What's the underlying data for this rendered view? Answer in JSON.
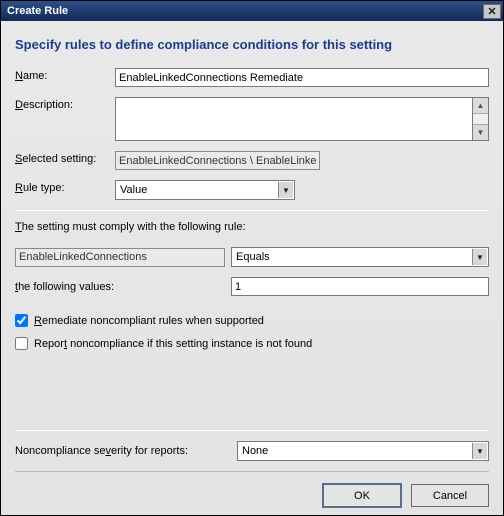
{
  "window": {
    "title": "Create Rule"
  },
  "header": {
    "heading": "Specify rules to define compliance conditions for this setting"
  },
  "labels": {
    "name": "Name:",
    "description": "Description:",
    "selected_setting": "Selected setting:",
    "rule_type": "Rule type:",
    "rule_sentence": "The setting must comply with the following rule:",
    "following_values": "the following values:",
    "remediate": "Remediate noncompliant rules when supported",
    "report_noncompliance": "Report noncompliance if this setting instance is not found",
    "severity": "Noncompliance severity for reports:"
  },
  "fields": {
    "name_value": "EnableLinkedConnections Remediate",
    "description_value": "",
    "selected_setting_value": "EnableLinkedConnections \\ EnableLinkedCon",
    "rule_type_value": "Value",
    "rule_setting_name": "EnableLinkedConnections",
    "operator": "Equals",
    "value": "1",
    "remediate_checked": true,
    "report_checked": false,
    "severity_value": "None"
  },
  "buttons": {
    "ok": "OK",
    "cancel": "Cancel"
  }
}
